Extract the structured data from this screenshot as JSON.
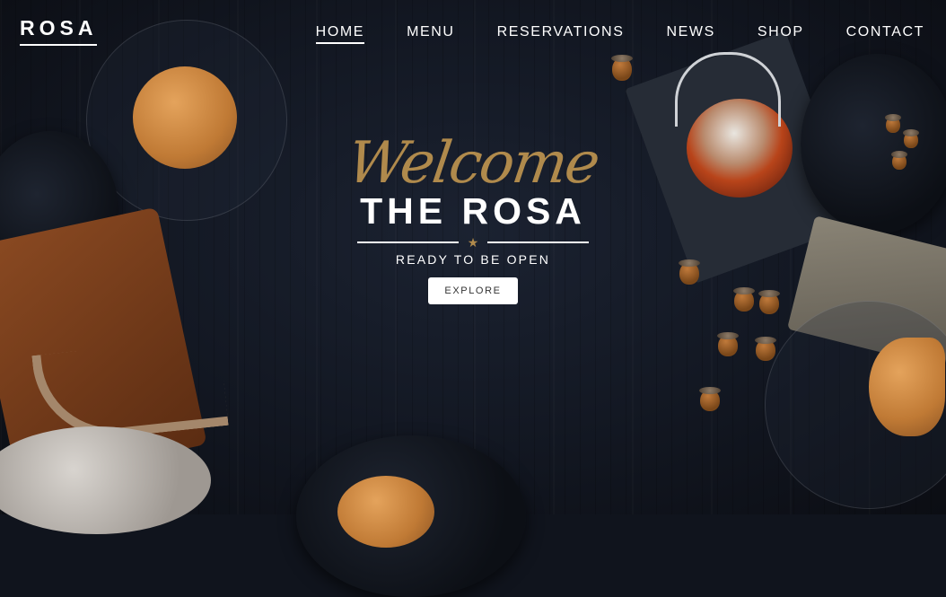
{
  "brand": "ROSA",
  "nav": {
    "items": [
      {
        "label": "HOME",
        "active": true
      },
      {
        "label": "MENU",
        "active": false
      },
      {
        "label": "RESERVATIONS",
        "active": false
      },
      {
        "label": "NEWS",
        "active": false
      },
      {
        "label": "SHOP",
        "active": false
      },
      {
        "label": "CONTACT",
        "active": false
      }
    ]
  },
  "hero": {
    "script_title": "Welcome",
    "title": "THE ROSA",
    "tagline": "READY TO BE OPEN",
    "cta_label": "EXPLORE",
    "divider_icon": "star-icon"
  },
  "colors": {
    "accent_gold": "#b08a4c",
    "background": "#131823",
    "text": "#ffffff"
  }
}
